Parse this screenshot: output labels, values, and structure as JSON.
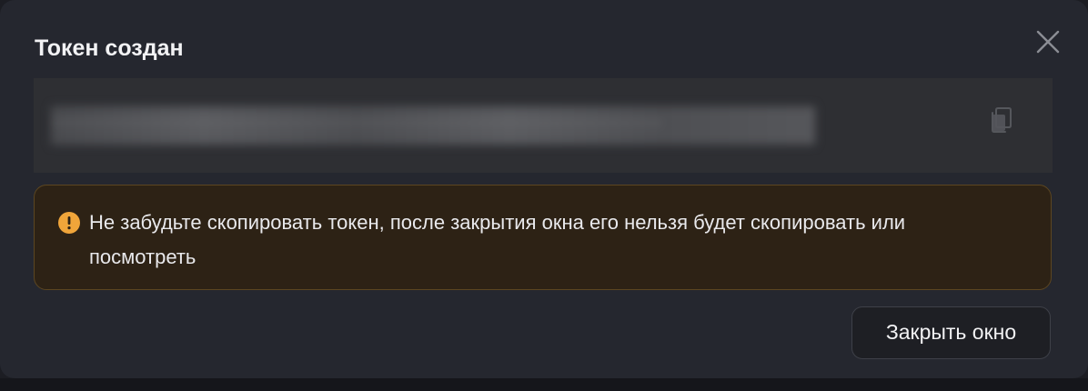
{
  "dialog": {
    "title": "Токен создан",
    "close_icon": "close-icon",
    "token": {
      "masked_value": "••••••••••••••••••••••••••••••••••••••••••••••••••••••••",
      "copy_icon": "copy-icon"
    },
    "warning": {
      "icon": "exclamation-circle-icon",
      "text": "Не забудьте скопировать токен, после закрытия окна его нельзя будет скопировать или посмотреть"
    },
    "close_button_label": "Закрыть окно"
  },
  "colors": {
    "modal_background": "#25272f",
    "token_background": "#2e2f33",
    "warning_background": "#2d2215",
    "warning_border": "#5c4621",
    "warning_icon": "#f0a53a"
  }
}
